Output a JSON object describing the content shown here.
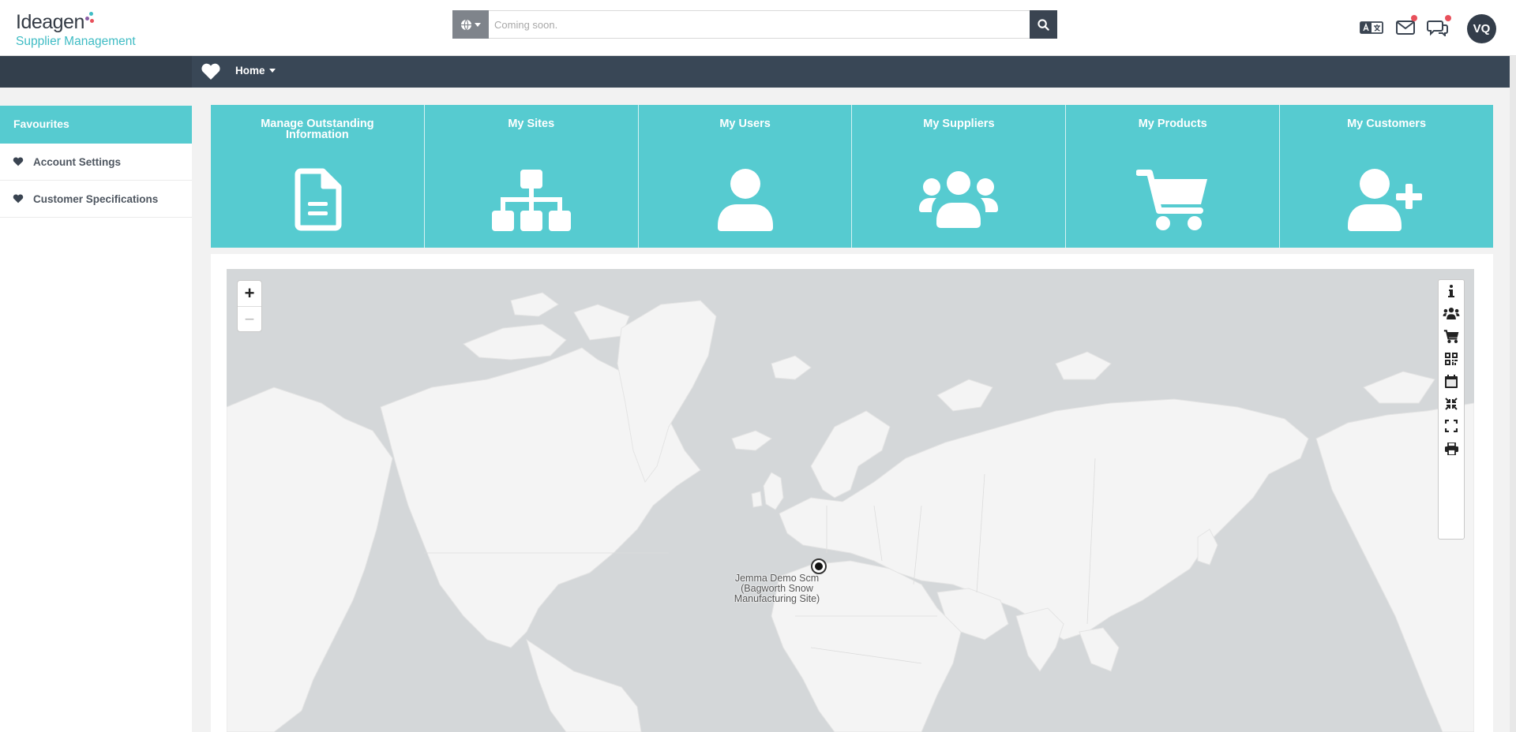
{
  "header": {
    "logo_brand": "Ideagen",
    "logo_subtitle": "Supplier Management",
    "search_placeholder": "Coming soon.",
    "avatar_initials": "VQ"
  },
  "nav": {
    "home_label": "Home"
  },
  "sidebar": {
    "header": "Favourites",
    "items": [
      {
        "label": "Account Settings"
      },
      {
        "label": "Customer Specifications"
      }
    ]
  },
  "tiles": [
    {
      "label": "Manage Outstanding Information",
      "icon": "document-icon"
    },
    {
      "label": "My Sites",
      "icon": "sitemap-icon"
    },
    {
      "label": "My Users",
      "icon": "user-icon"
    },
    {
      "label": "My Suppliers",
      "icon": "users-group-icon"
    },
    {
      "label": "My Products",
      "icon": "cart-icon"
    },
    {
      "label": "My Customers",
      "icon": "user-plus-icon"
    }
  ],
  "map": {
    "site_label": "Jemma Demo Scm (Bagworth Snow Manufacturing Site)",
    "zoom_in": "+",
    "zoom_out": "−"
  },
  "colors": {
    "accent": "#56cbd0",
    "navbar": "#394756",
    "dark": "#333d4a",
    "notification": "#e8505b"
  }
}
